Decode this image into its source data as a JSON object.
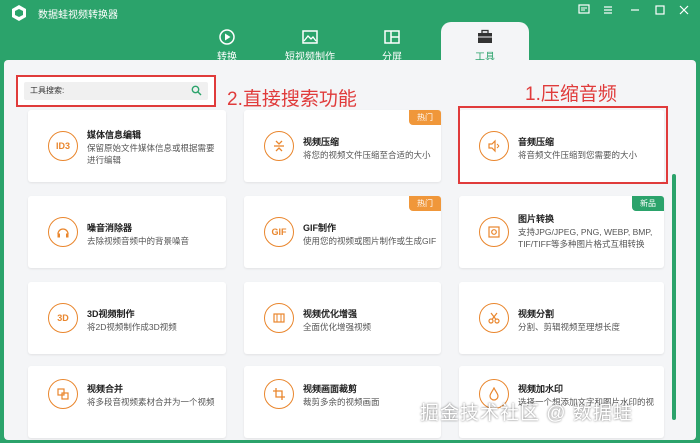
{
  "app": {
    "title": "数据蛙视频转换器"
  },
  "tabs": [
    {
      "label": "转换",
      "icon": "convert-icon"
    },
    {
      "label": "短视频制作",
      "icon": "image-icon"
    },
    {
      "label": "分屏",
      "icon": "split-screen-icon"
    },
    {
      "label": "工具",
      "icon": "toolbox-icon",
      "active": true
    }
  ],
  "search": {
    "label": "工具搜索:"
  },
  "annotations": {
    "search": "2.直接搜索功能",
    "compress_audio": "1.压缩音频"
  },
  "cards": [
    {
      "title": "媒体信息编辑",
      "desc": "保留原始文件媒体信息或根据需要进行编辑",
      "icon": "ID3"
    },
    {
      "title": "视频压缩",
      "desc": "将您的视频文件压缩至合适的大小",
      "badge": "热门"
    },
    {
      "title": "音频压缩",
      "desc": "将音频文件压缩到您需要的大小"
    },
    {
      "title": "噪音消除器",
      "desc": "去除视频音频中的背景噪音"
    },
    {
      "title": "GIF制作",
      "desc": "使用您的视频或图片制作或生成GIF",
      "badge": "热门",
      "icon": "GIF"
    },
    {
      "title": "图片转换",
      "desc": "支持JPG/JPEG, PNG, WEBP, BMP, TIF/TIFF等多种图片格式互相转换",
      "badge": "新品"
    },
    {
      "title": "3D视频制作",
      "desc": "将2D视频制作成3D视频",
      "icon": "3D"
    },
    {
      "title": "视频优化增强",
      "desc": "全面优化增强视频"
    },
    {
      "title": "视频分割",
      "desc": "分割、剪辑视频至理想长度"
    },
    {
      "title": "视频合并",
      "desc": "将多段音视频素材合并为一个视频"
    },
    {
      "title": "视频画面裁剪",
      "desc": "裁剪多余的视频画面"
    },
    {
      "title": "视频加水印",
      "desc": "选择一个想添加文字和图片水印的视"
    }
  ],
  "watermark": "掘金技术社区 @ 数据蛙",
  "colors": {
    "brand": "#2ba36b",
    "accent": "#e9862d",
    "highlight": "#e03b3b"
  }
}
